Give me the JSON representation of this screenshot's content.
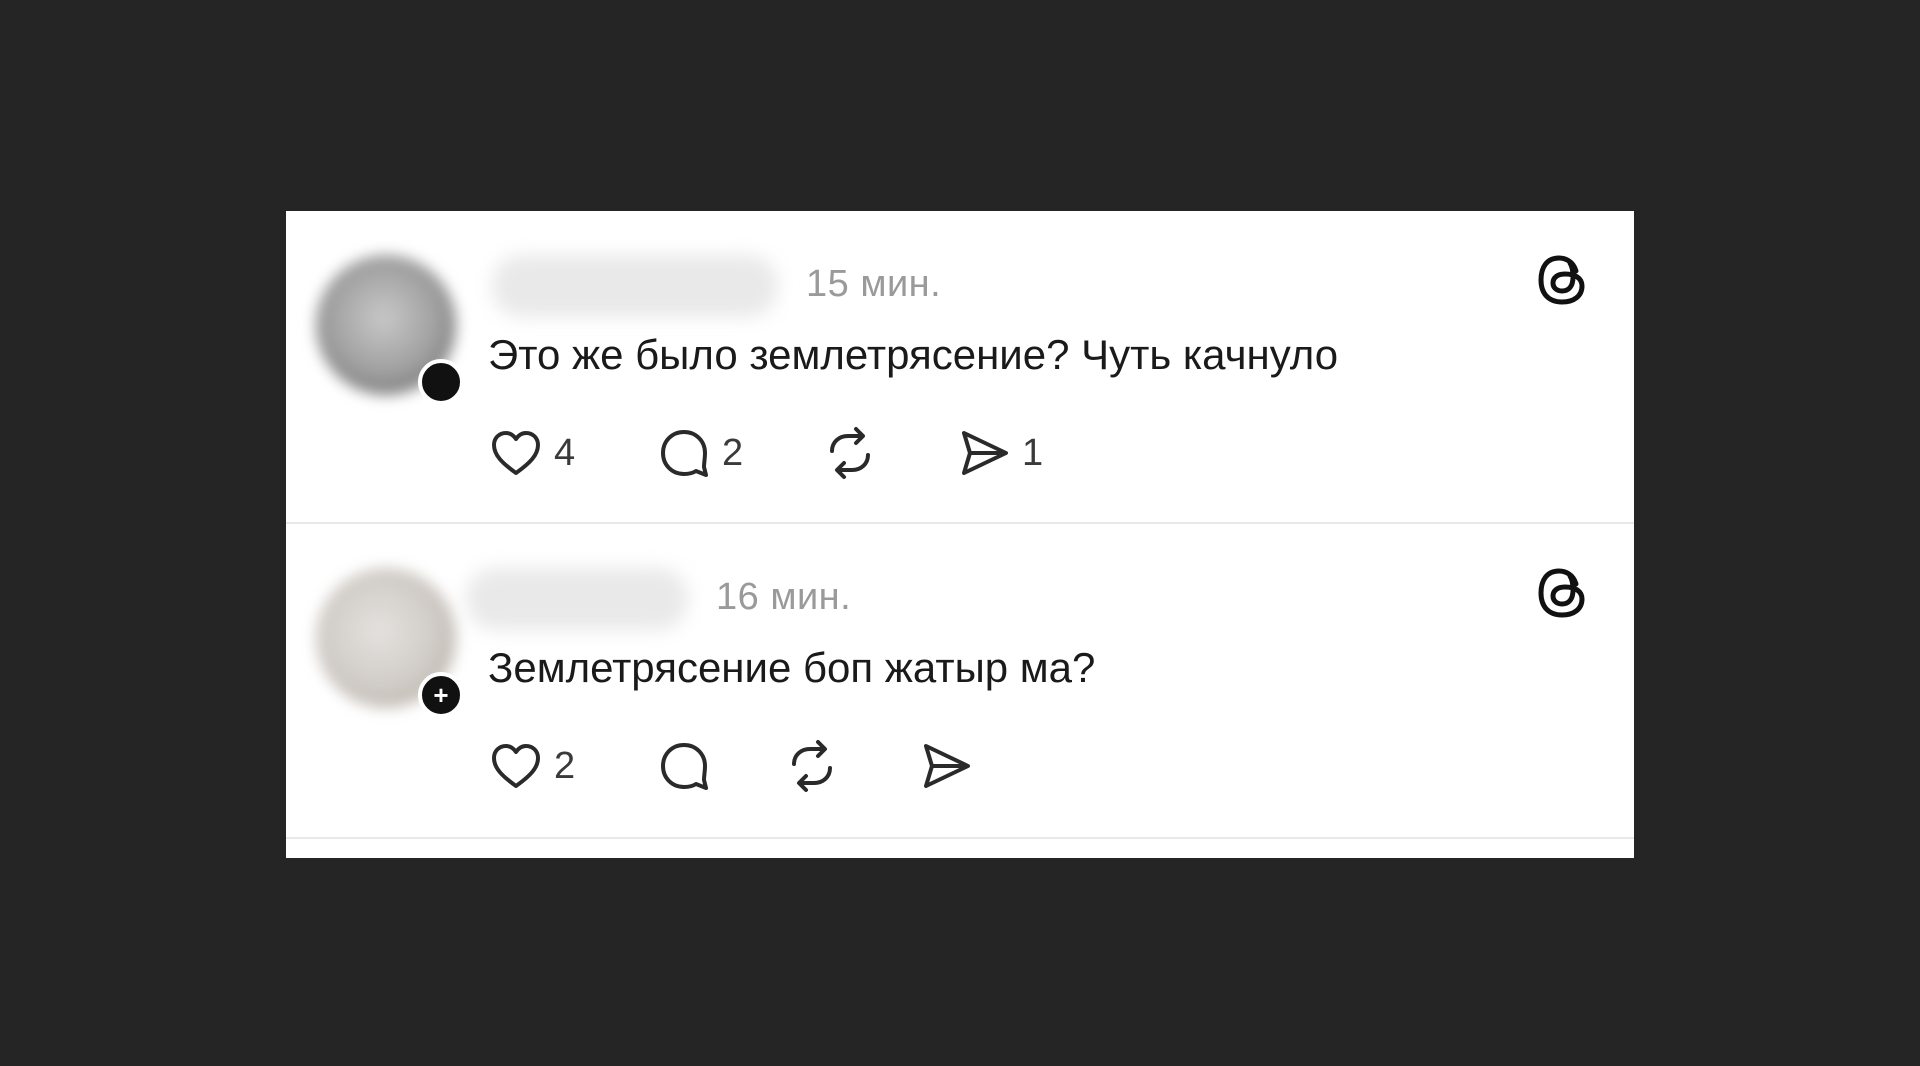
{
  "posts": [
    {
      "timestamp": "15 мин.",
      "text": "Это же было землетрясение? Чуть качнуло",
      "likes": "4",
      "replies": "2",
      "reposts": "",
      "shares": "1"
    },
    {
      "timestamp": "16 мин.",
      "text": "Землетрясение боп жатыр ма?",
      "likes": "2",
      "replies": "",
      "reposts": "",
      "shares": ""
    }
  ],
  "icons": {
    "brand": "threads-logo-icon",
    "like": "heart-icon",
    "reply": "comment-bubble-icon",
    "repost": "repost-icon",
    "share": "send-icon"
  },
  "colors": {
    "background": "#252525",
    "card": "#ffffff",
    "text": "#1a1a1a",
    "muted": "#9a9a9a"
  }
}
